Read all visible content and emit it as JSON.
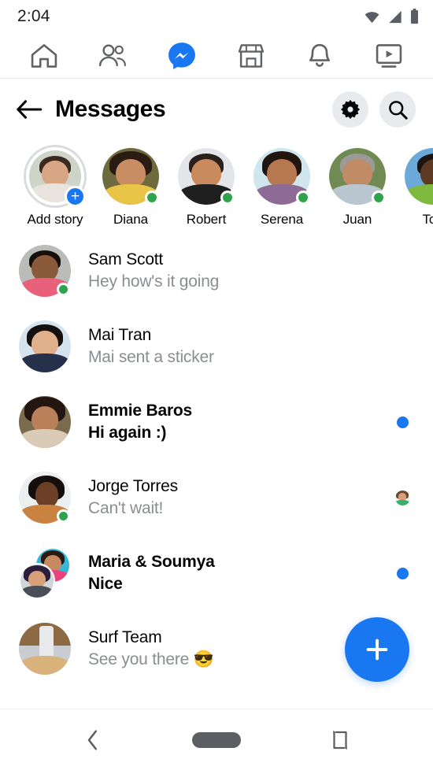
{
  "statusbar": {
    "time": "2:04",
    "icons": [
      "wifi-icon",
      "cellular-signal-icon",
      "battery-icon"
    ]
  },
  "tabbar": {
    "items": [
      {
        "name": "home-tab",
        "icon": "home-icon",
        "active": false
      },
      {
        "name": "friends-tab",
        "icon": "people-icon",
        "active": false
      },
      {
        "name": "messenger-tab",
        "icon": "messenger-icon",
        "active": true
      },
      {
        "name": "marketplace-tab",
        "icon": "store-icon",
        "active": false
      },
      {
        "name": "notifications-tab",
        "icon": "bell-icon",
        "active": false
      },
      {
        "name": "watch-tab",
        "icon": "video-screen-icon",
        "active": false
      }
    ],
    "active_color": "#1a77f2",
    "inactive_color": "#606266"
  },
  "header": {
    "back_icon": "arrow-left-icon",
    "title": "Messages",
    "settings_icon": "gear-icon",
    "search_icon": "search-icon"
  },
  "stories": [
    {
      "label": "Add story",
      "add": true,
      "online": false,
      "colors": {
        "bg": "#cfd4c9",
        "hair": "#3a2a22",
        "skin": "#d8a684",
        "body": "#e8e4dd"
      }
    },
    {
      "label": "Diana",
      "add": false,
      "online": true,
      "colors": {
        "bg": "#6d6a3d",
        "hair": "#2b1c13",
        "skin": "#c98d63",
        "body": "#e8c547"
      }
    },
    {
      "label": "Robert",
      "add": false,
      "online": true,
      "colors": {
        "bg": "#e3e5e8",
        "hair": "#2a211c",
        "skin": "#c98a5e",
        "body": "#201f20"
      }
    },
    {
      "label": "Serena",
      "add": false,
      "online": true,
      "colors": {
        "bg": "#cfe6ee",
        "hair": "#20150f",
        "skin": "#b5784f",
        "body": "#8d6b95"
      }
    },
    {
      "label": "Juan",
      "add": false,
      "online": true,
      "colors": {
        "bg": "#6f8a52",
        "hair": "#9b9a98",
        "skin": "#c08b65",
        "body": "#b9c6cf"
      }
    },
    {
      "label": "Ton",
      "add": false,
      "online": false,
      "colors": {
        "bg": "#6aa9d8",
        "hair": "#1c1410",
        "skin": "#5e3a22",
        "body": "#7fb93e"
      }
    }
  ],
  "conversations": [
    {
      "name": "Sam Scott",
      "snippet": "Hey how's it going",
      "unread": false,
      "online": true,
      "group": false,
      "right": "none",
      "colors": {
        "bg": "#b9bcb8",
        "hair": "#16100c",
        "skin": "#8a5a3a",
        "body": "#e8607a"
      }
    },
    {
      "name": "Mai Tran",
      "snippet": "Mai sent a sticker",
      "unread": false,
      "online": false,
      "group": false,
      "right": "none",
      "colors": {
        "bg": "#d5e3ee",
        "hair": "#15100d",
        "skin": "#e0b08c",
        "body": "#25304a"
      }
    },
    {
      "name": "Emmie Baros",
      "snippet": "Hi again :)",
      "unread": true,
      "online": false,
      "group": false,
      "right": "unread-dot",
      "colors": {
        "bg": "#7a6a4e",
        "hair": "#231611",
        "skin": "#b8815a",
        "body": "#d9cbb5"
      }
    },
    {
      "name": "Jorge Torres",
      "snippet": "Can't wait!",
      "unread": false,
      "online": true,
      "group": false,
      "right": "seen-avatar",
      "colors": {
        "bg": "#eceef0",
        "hair": "#140f0c",
        "skin": "#6b4026",
        "body": "#c9823f"
      }
    },
    {
      "name": "Maria & Soumya",
      "snippet": "Nice",
      "unread": true,
      "online": false,
      "group": true,
      "right": "unread-dot",
      "colors": {
        "bg": "#37b6d6",
        "hair": "#2a1a12",
        "skin": "#c58a61",
        "body": "#e8437d"
      },
      "colors2": {
        "bg": "#cfd6d8",
        "hair": "#2a1e3c",
        "skin": "#d8a077",
        "body": "#4a4e57"
      }
    },
    {
      "name": "Surf Team",
      "snippet": "See you there 😎",
      "unread": false,
      "online": false,
      "group": false,
      "right": "none",
      "colors": {
        "bg": "#c9ccd1",
        "hair": "#8e6a44",
        "skin": "#e7e9ec",
        "body": "#d9b27c"
      }
    }
  ],
  "fab": {
    "icon": "plus-icon",
    "label": "+",
    "color": "#1a77f2"
  },
  "navbar": {
    "items": [
      {
        "name": "android-back-button",
        "icon": "chevron-left-icon"
      },
      {
        "name": "android-home-button",
        "icon": "home-pill-icon"
      },
      {
        "name": "android-rotate-button",
        "icon": "rotate-screen-icon"
      }
    ]
  }
}
